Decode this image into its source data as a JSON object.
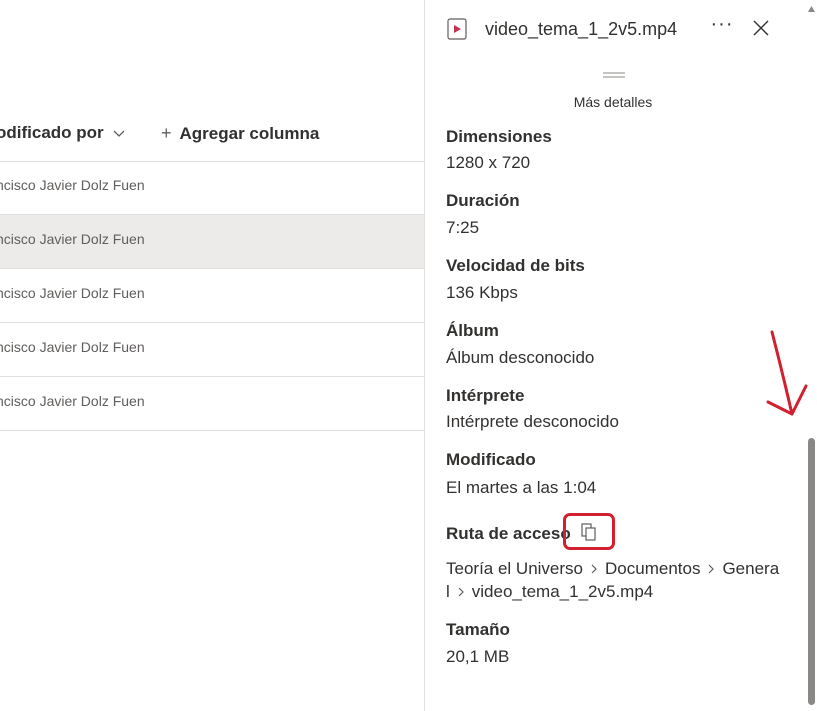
{
  "list": {
    "col_modified_by": "odificado por",
    "add_column": "Agregar columna",
    "rows": [
      {
        "modified_by": "ncisco Javier Dolz Fuen",
        "selected": false
      },
      {
        "modified_by": "ncisco Javier Dolz Fuen",
        "selected": true
      },
      {
        "modified_by": "ncisco Javier Dolz Fuen",
        "selected": false
      },
      {
        "modified_by": "ncisco Javier Dolz Fuen",
        "selected": false
      },
      {
        "modified_by": "ncisco Javier Dolz Fuen",
        "selected": false
      }
    ]
  },
  "details": {
    "file_name": "video_tema_1_2v5.mp4",
    "more_label": "···",
    "more_details": "Más detalles",
    "fields": {
      "dimensions": {
        "label": "Dimensiones",
        "value": "1280 x 720"
      },
      "duration": {
        "label": "Duración",
        "value": "7:25"
      },
      "bitrate": {
        "label": "Velocidad de bits",
        "value": "136 Kbps"
      },
      "album": {
        "label": "Álbum",
        "value": "Álbum desconocido"
      },
      "artist": {
        "label": "Intérprete",
        "value": "Intérprete desconocido"
      },
      "modified": {
        "label": "Modificado",
        "value": "El martes a las 1:04"
      },
      "path": {
        "label": "Ruta de acceso",
        "line1": [
          "Teoría el Universo",
          "Documentos",
          "Genera"
        ],
        "line2": [
          "l",
          "video_tema_1_2v5.mp4"
        ]
      },
      "size": {
        "label": "Tamaño",
        "value": "20,1 MB"
      }
    }
  },
  "colors": {
    "accent": "#c4314b",
    "highlight_red": "#d1202f",
    "selected_row": "#edebe9",
    "text": "#323130"
  },
  "icons": {
    "file": "video-file-icon",
    "close": "close-icon",
    "copy": "copy-icon",
    "chevron": "chevron-down-icon",
    "arrow": "red-arrow-annotation"
  }
}
